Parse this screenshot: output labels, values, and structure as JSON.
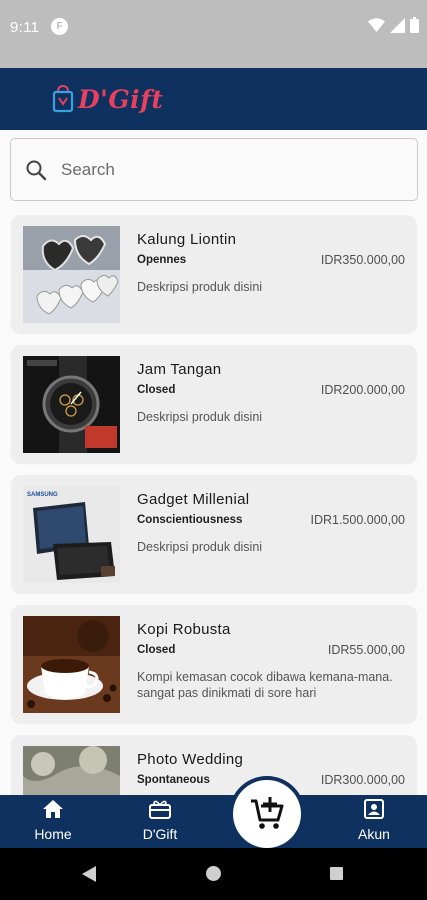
{
  "status_bar": {
    "time": "9:11",
    "app_icon_letter": "F",
    "icons": [
      "wifi-icon",
      "signal-icon",
      "battery-icon"
    ]
  },
  "header": {
    "logo_text": "D'Gift",
    "logo_icon": "shopping-bag-icon"
  },
  "search": {
    "placeholder": "Search",
    "value": ""
  },
  "products": [
    {
      "name": "Kalung Liontin",
      "category": "Opennes",
      "price": "IDR350.000,00",
      "description": "Deskripsi produk disini",
      "thumb": "necklace"
    },
    {
      "name": "Jam Tangan",
      "category": "Closed",
      "price": "IDR200.000,00",
      "description": "Deskripsi produk disini",
      "thumb": "watch"
    },
    {
      "name": "Gadget Millenial",
      "category": "Conscientiousness",
      "price": "IDR1.500.000,00",
      "description": "Deskripsi produk disini",
      "thumb": "phone",
      "thumb_text": "SAMSUNG"
    },
    {
      "name": "Kopi Robusta",
      "category": "Closed",
      "price": "IDR55.000,00",
      "description": "Kompi kemasan cocok dibawa kemana-mana. sangat pas dinikmati di sore hari",
      "thumb": "coffee"
    },
    {
      "name": "Photo Wedding",
      "category": "Spontaneous",
      "price": "IDR300.000,00",
      "description": "",
      "thumb": "wedding"
    }
  ],
  "bottom_nav": {
    "home_label": "Home",
    "gift_label": "D'Gift",
    "akun_label": "Akun",
    "cart_icon": "add-to-cart-icon"
  },
  "colors": {
    "primary": "#0e3160",
    "brand_red": "#e8405d",
    "card_bg": "#eeeeee",
    "status_bar": "#bdbdbd"
  }
}
